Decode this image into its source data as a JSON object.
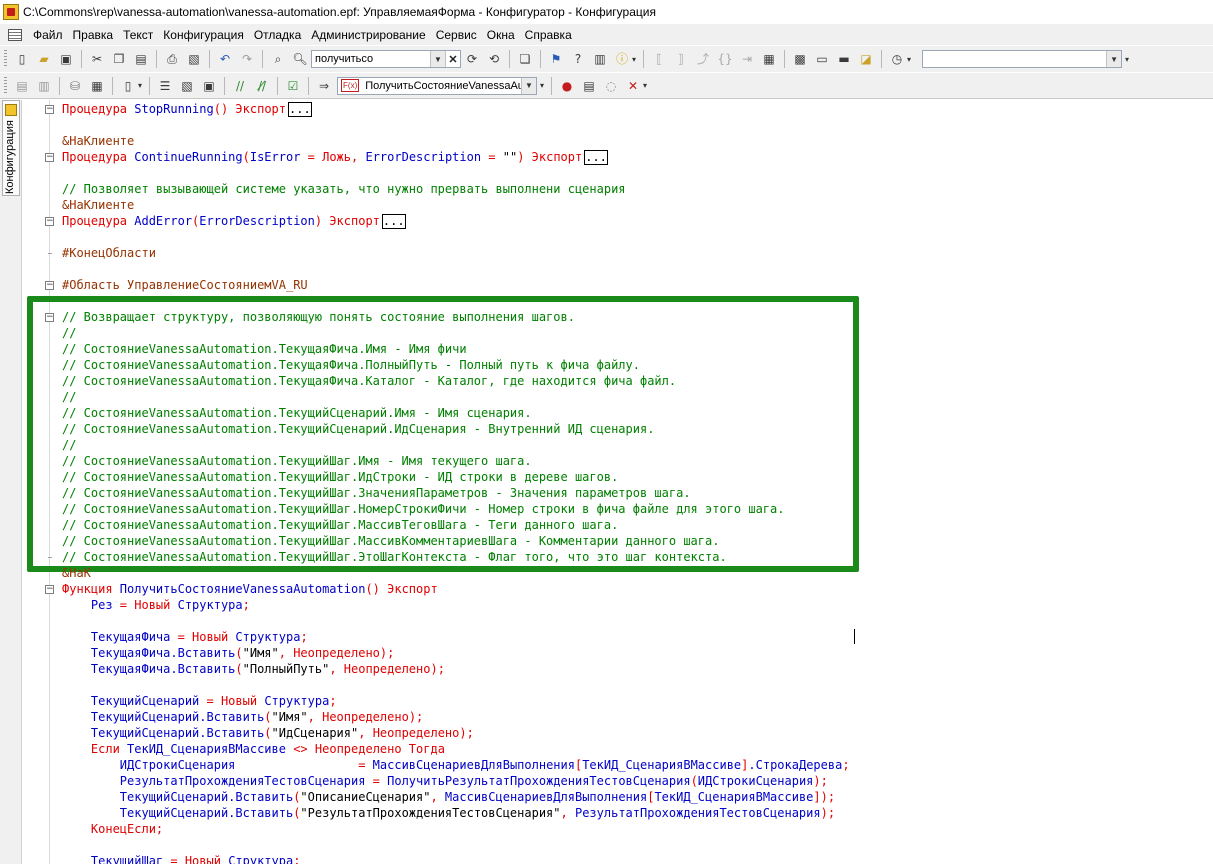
{
  "window": {
    "title": "C:\\Commons\\rep\\vanessa-automation\\vanessa-automation.epf: УправляемаяФорма - Конфигуратор - Конфигурация"
  },
  "menu": [
    {
      "label": "Файл",
      "accel": "Ф"
    },
    {
      "label": "Правка",
      "accel": "П"
    },
    {
      "label": "Текст",
      "accel": "Т"
    },
    {
      "label": "Конфигурация",
      "accel": "К"
    },
    {
      "label": "Отладка",
      "accel": "О"
    },
    {
      "label": "Администрирование",
      "accel": "А"
    },
    {
      "label": "Сервис",
      "accel": "С"
    },
    {
      "label": "Окна",
      "accel": "О"
    },
    {
      "label": "Справка",
      "accel": "С"
    }
  ],
  "toolbar": {
    "search_value": "получитьсо",
    "method_value": "ПолучитьСостояниеVanessaAuto",
    "method_badge": "F(x)",
    "right_combo_value": ""
  },
  "side_panel": {
    "tab_label": "Конфигурация"
  },
  "code": [
    {
      "fold": "minus",
      "parts": [
        [
          "kw",
          "Процедура "
        ],
        [
          "id",
          "StopRunning"
        ],
        [
          "pun",
          "() "
        ],
        [
          "kw",
          "Экспорт"
        ]
      ],
      "ellipsis": true
    },
    {
      "parts": []
    },
    {
      "parts": [
        [
          "pp",
          "&НаКлиенте"
        ]
      ]
    },
    {
      "fold": "minus",
      "parts": [
        [
          "kw",
          "Процедура "
        ],
        [
          "id",
          "ContinueRunning"
        ],
        [
          "pun",
          "("
        ],
        [
          "id",
          "IsError "
        ],
        [
          "pun",
          "= "
        ],
        [
          "kw",
          "Ложь"
        ],
        [
          "pun",
          ", "
        ],
        [
          "id",
          "ErrorDescription "
        ],
        [
          "pun",
          "= "
        ],
        [
          "str",
          "\"\""
        ],
        [
          "pun",
          ") "
        ],
        [
          "kw",
          "Экспорт"
        ]
      ],
      "ellipsis": true
    },
    {
      "parts": []
    },
    {
      "parts": [
        [
          "cm",
          "// Позволяет вызывающей системе указать, что нужно прервать выполнени сценария"
        ]
      ]
    },
    {
      "parts": [
        [
          "pp",
          "&НаКлиенте"
        ]
      ]
    },
    {
      "fold": "minus",
      "parts": [
        [
          "kw",
          "Процедура "
        ],
        [
          "id",
          "AddError"
        ],
        [
          "pun",
          "("
        ],
        [
          "id",
          "ErrorDescription"
        ],
        [
          "pun",
          ") "
        ],
        [
          "kw",
          "Экспорт"
        ]
      ],
      "ellipsis": true
    },
    {
      "parts": []
    },
    {
      "tick": true,
      "parts": [
        [
          "pp",
          "#КонецОбласти"
        ]
      ]
    },
    {
      "parts": []
    },
    {
      "fold": "minus",
      "parts": [
        [
          "pp",
          "#Область УправлениеСостояниемVA_RU"
        ]
      ]
    },
    {
      "parts": []
    },
    {
      "fold": "minus",
      "parts": [
        [
          "cm",
          "// Возвращает структуру, позволяющую понять состояние выполнения шагов."
        ]
      ]
    },
    {
      "parts": [
        [
          "cm",
          "//"
        ]
      ]
    },
    {
      "parts": [
        [
          "cm",
          "// СостояниеVanessaAutomation.ТекущаяФича.Имя - Имя фичи"
        ]
      ]
    },
    {
      "parts": [
        [
          "cm",
          "// СостояниеVanessaAutomation.ТекущаяФича.ПолныйПуть - Полный путь к фича файлу."
        ]
      ]
    },
    {
      "parts": [
        [
          "cm",
          "// СостояниеVanessaAutomation.ТекущаяФича.Каталог - Каталог, где находится фича файл."
        ]
      ]
    },
    {
      "parts": [
        [
          "cm",
          "//"
        ]
      ]
    },
    {
      "parts": [
        [
          "cm",
          "// СостояниеVanessaAutomation.ТекущийСценарий.Имя - Имя сценария."
        ]
      ]
    },
    {
      "parts": [
        [
          "cm",
          "// СостояниеVanessaAutomation.ТекущийСценарий.ИдСценария - Внутренний ИД сценария."
        ]
      ]
    },
    {
      "parts": [
        [
          "cm",
          "//"
        ]
      ]
    },
    {
      "parts": [
        [
          "cm",
          "// СостояниеVanessaAutomation.ТекущийШаг.Имя - Имя текущего шага."
        ]
      ]
    },
    {
      "parts": [
        [
          "cm",
          "// СостояниеVanessaAutomation.ТекущийШаг.ИдСтроки - ИД строки в дереве шагов."
        ]
      ]
    },
    {
      "parts": [
        [
          "cm",
          "// СостояниеVanessaAutomation.ТекущийШаг.ЗначенияПараметров - Значения параметров шага."
        ]
      ]
    },
    {
      "parts": [
        [
          "cm",
          "// СостояниеVanessaAutomation.ТекущийШаг.НомерСтрокиФичи - Номер строки в фича файле для этого шага."
        ]
      ]
    },
    {
      "parts": [
        [
          "cm",
          "// СостояниеVanessaAutomation.ТекущийШаг.МассивТеговШага - Теги данного шага."
        ]
      ]
    },
    {
      "parts": [
        [
          "cm",
          "// СостояниеVanessaAutomation.ТекущийШаг.МассивКомментариевШага - Комментарии данного шага."
        ]
      ]
    },
    {
      "tick": true,
      "parts": [
        [
          "cm",
          "// СостояниеVanessaAutomation.ТекущийШаг.ЭтоШагКонтекста - Флаг того, что это шаг контекста."
        ]
      ]
    },
    {
      "parts": [
        [
          "pp",
          "&НаК"
        ]
      ]
    },
    {
      "fold": "minus",
      "parts": [
        [
          "kw",
          "Функция "
        ],
        [
          "id",
          "ПолучитьСостояниеVanessaAutomation"
        ],
        [
          "pun",
          "() "
        ],
        [
          "kw",
          "Экспорт"
        ]
      ]
    },
    {
      "parts": [
        [
          "id",
          "    Рез "
        ],
        [
          "pun",
          "= "
        ],
        [
          "kw",
          "Новый "
        ],
        [
          "id",
          "Структура"
        ],
        [
          "pun",
          ";"
        ]
      ]
    },
    {
      "parts": []
    },
    {
      "parts": [
        [
          "id",
          "    ТекущаяФича "
        ],
        [
          "pun",
          "= "
        ],
        [
          "kw",
          "Новый "
        ],
        [
          "id",
          "Структура"
        ],
        [
          "pun",
          ";"
        ]
      ]
    },
    {
      "parts": [
        [
          "id",
          "    ТекущаяФича.Вставить"
        ],
        [
          "pun",
          "("
        ],
        [
          "str",
          "\"Имя\""
        ],
        [
          "pun",
          ", "
        ],
        [
          "kw",
          "Неопределено"
        ],
        [
          "pun",
          ");"
        ]
      ]
    },
    {
      "parts": [
        [
          "id",
          "    ТекущаяФича.Вставить"
        ],
        [
          "pun",
          "("
        ],
        [
          "str",
          "\"ПолныйПуть\""
        ],
        [
          "pun",
          ", "
        ],
        [
          "kw",
          "Неопределено"
        ],
        [
          "pun",
          ");"
        ]
      ]
    },
    {
      "parts": []
    },
    {
      "parts": [
        [
          "id",
          "    ТекущийСценарий "
        ],
        [
          "pun",
          "= "
        ],
        [
          "kw",
          "Новый "
        ],
        [
          "id",
          "Структура"
        ],
        [
          "pun",
          ";"
        ]
      ]
    },
    {
      "parts": [
        [
          "id",
          "    ТекущийСценарий.Вставить"
        ],
        [
          "pun",
          "("
        ],
        [
          "str",
          "\"Имя\""
        ],
        [
          "pun",
          ", "
        ],
        [
          "kw",
          "Неопределено"
        ],
        [
          "pun",
          ");"
        ]
      ]
    },
    {
      "parts": [
        [
          "id",
          "    ТекущийСценарий.Вставить"
        ],
        [
          "pun",
          "("
        ],
        [
          "str",
          "\"ИдСценария\""
        ],
        [
          "pun",
          ", "
        ],
        [
          "kw",
          "Неопределено"
        ],
        [
          "pun",
          ");"
        ]
      ]
    },
    {
      "parts": [
        [
          "kw",
          "    Если "
        ],
        [
          "id",
          "ТекИД_СценарияВМассиве "
        ],
        [
          "pun",
          "<> "
        ],
        [
          "kw",
          "Неопределено Тогда"
        ]
      ]
    },
    {
      "parts": [
        [
          "id",
          "        ИДСтрокиСценария                 "
        ],
        [
          "pun",
          "= "
        ],
        [
          "id",
          "МассивСценариевДляВыполнения"
        ],
        [
          "pun",
          "["
        ],
        [
          "id",
          "ТекИД_СценарияВМассиве"
        ],
        [
          "pun",
          "]"
        ],
        [
          "id",
          ".СтрокаДерева"
        ],
        [
          "pun",
          ";"
        ]
      ]
    },
    {
      "parts": [
        [
          "id",
          "        РезультатПрохожденияТестовСценария "
        ],
        [
          "pun",
          "= "
        ],
        [
          "id",
          "ПолучитьРезультатПрохожденияТестовСценария"
        ],
        [
          "pun",
          "("
        ],
        [
          "id",
          "ИДСтрокиСценария"
        ],
        [
          "pun",
          ");"
        ]
      ]
    },
    {
      "parts": [
        [
          "id",
          "        ТекущийСценарий.Вставить"
        ],
        [
          "pun",
          "("
        ],
        [
          "str",
          "\"ОписаниеСценария\""
        ],
        [
          "pun",
          ", "
        ],
        [
          "id",
          "МассивСценариевДляВыполнения"
        ],
        [
          "pun",
          "["
        ],
        [
          "id",
          "ТекИД_СценарияВМассиве"
        ],
        [
          "pun",
          "]);"
        ]
      ]
    },
    {
      "parts": [
        [
          "id",
          "        ТекущийСценарий.Вставить"
        ],
        [
          "pun",
          "("
        ],
        [
          "str",
          "\"РезультатПрохожденияТестовСценария\""
        ],
        [
          "pun",
          ", "
        ],
        [
          "id",
          "РезультатПрохожденияТестовСценария"
        ],
        [
          "pun",
          ");"
        ]
      ]
    },
    {
      "parts": [
        [
          "kw",
          "    КонецЕсли"
        ],
        [
          "pun",
          ";"
        ]
      ]
    },
    {
      "parts": []
    },
    {
      "parts": [
        [
          "id",
          "    ТекущийШаг "
        ],
        [
          "pun",
          "= "
        ],
        [
          "kw",
          "Новый "
        ],
        [
          "id",
          "Структура"
        ],
        [
          "pun",
          ";"
        ]
      ]
    }
  ],
  "colors": {
    "highlight_border": "#1a8a1a",
    "keyword": "#e00000",
    "identifier": "#0000c8",
    "comment": "#008000",
    "preprocessor": "#963200"
  }
}
